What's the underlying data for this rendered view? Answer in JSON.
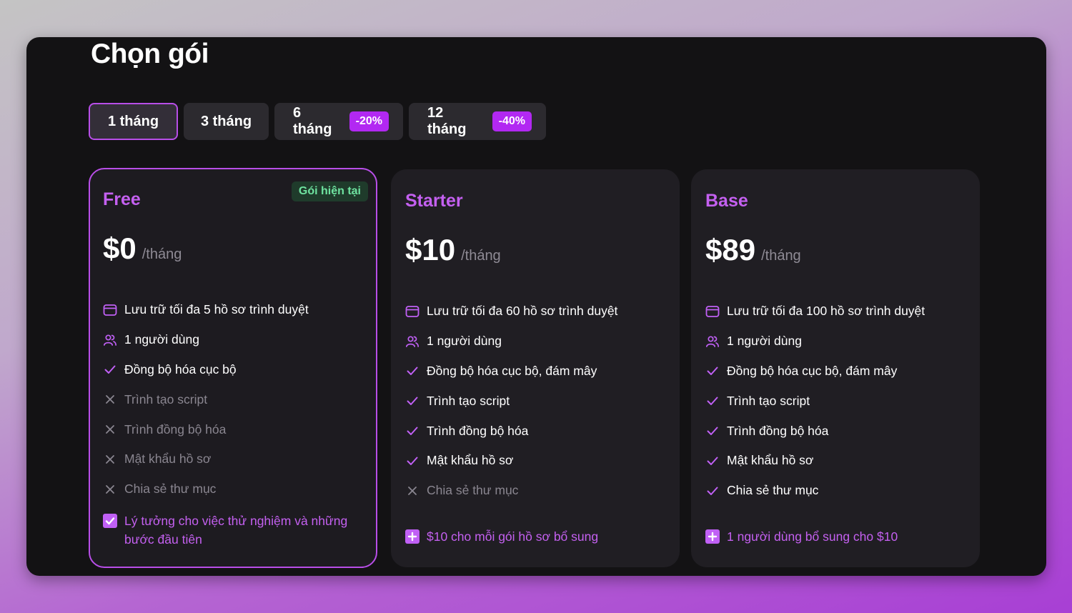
{
  "title": "Chọn gói",
  "tabs": [
    {
      "label": "1 tháng",
      "discount": ""
    },
    {
      "label": "3 tháng",
      "discount": ""
    },
    {
      "label": "6 tháng",
      "discount": "-20%"
    },
    {
      "label": "12 tháng",
      "discount": "-40%"
    }
  ],
  "colors": {
    "accent": "#b84ee8",
    "badge": "#b228f2",
    "current_badge": "#6fe3a0"
  },
  "plans": [
    {
      "name": "Free",
      "current_badge": "Gói hiện tại",
      "price": "$0",
      "period": "/tháng",
      "features": [
        {
          "text": "Lưu trữ tối đa 5 hồ sơ trình duyệt",
          "icon": "browser-icon"
        },
        {
          "text": "1 người dùng",
          "icon": "users-icon"
        },
        {
          "text": "Đồng bộ hóa cục bộ",
          "icon": "check-icon"
        },
        {
          "text": "Trình tạo script",
          "icon": "x-icon"
        },
        {
          "text": "Trình đồng bộ hóa",
          "icon": "x-icon"
        },
        {
          "text": "Mật khẩu hồ sơ",
          "icon": "x-icon"
        },
        {
          "text": "Chia sẻ thư mục",
          "icon": "x-icon"
        }
      ],
      "extra": "Lý tưởng cho việc thử nghiệm và những bước đầu tiên"
    },
    {
      "name": "Starter",
      "price": "$10",
      "period": "/tháng",
      "features": [
        {
          "text": "Lưu trữ tối đa 60 hồ sơ trình duyệt",
          "icon": "browser-icon"
        },
        {
          "text": "1 người dùng",
          "icon": "users-icon"
        },
        {
          "text": "Đồng bộ hóa cục bộ, đám mây",
          "icon": "check-icon"
        },
        {
          "text": "Trình tạo script",
          "icon": "check-icon"
        },
        {
          "text": "Trình đồng bộ hóa",
          "icon": "check-icon"
        },
        {
          "text": "Mật khẩu hồ sơ",
          "icon": "check-icon"
        },
        {
          "text": "Chia sẻ thư mục",
          "icon": "x-icon"
        }
      ],
      "extra": "$10 cho mỗi gói hồ sơ bổ sung"
    },
    {
      "name": "Base",
      "price": "$89",
      "period": "/tháng",
      "features": [
        {
          "text": "Lưu trữ tối đa 100 hồ sơ trình duyệt",
          "icon": "browser-icon"
        },
        {
          "text": "1 người dùng",
          "icon": "users-icon"
        },
        {
          "text": "Đồng bộ hóa cục bộ, đám mây",
          "icon": "check-icon"
        },
        {
          "text": "Trình tạo script",
          "icon": "check-icon"
        },
        {
          "text": "Trình đồng bộ hóa",
          "icon": "check-icon"
        },
        {
          "text": "Mật khẩu hồ sơ",
          "icon": "check-icon"
        },
        {
          "text": "Chia sẻ thư mục",
          "icon": "check-icon"
        }
      ],
      "extra": "1 người dùng bổ sung cho $10"
    }
  ]
}
